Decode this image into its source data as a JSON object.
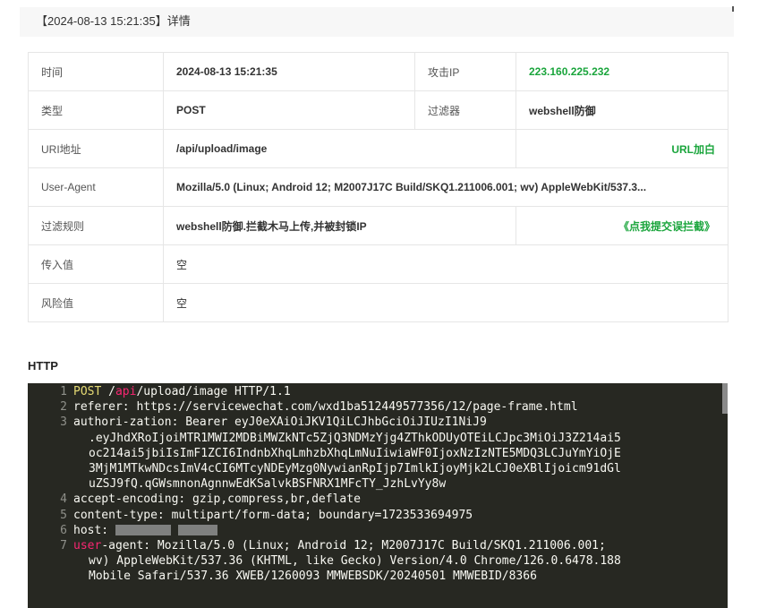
{
  "header": {
    "title": "【2024-08-13 15:21:35】详情"
  },
  "details": {
    "time_label": "时间",
    "time_value": "2024-08-13 15:21:35",
    "attack_ip_label": "攻击IP",
    "attack_ip_value": "223.160.225.232",
    "type_label": "类型",
    "type_value": "POST",
    "filter_label": "过滤器",
    "filter_value": "webshell防御",
    "uri_label": "URI地址",
    "uri_value": "/api/upload/image",
    "uri_action": "URL加白",
    "ua_label": "User-Agent",
    "ua_value": "Mozilla/5.0 (Linux; Android 12; M2007J17C Build/SKQ1.211006.001; wv) AppleWebKit/537.3...",
    "rule_label": "过滤规则",
    "rule_value": "webshell防御.拦截木马上传,并被封锁IP",
    "rule_action": "《点我提交误拦截》",
    "input_label": "传入值",
    "input_value": "空",
    "risk_label": "风险值",
    "risk_value": "空"
  },
  "http": {
    "title": "HTTP",
    "l1_ln": "1",
    "l1_method": "POST",
    "l1_sp": " /",
    "l1_api": "api",
    "l1_rest": "/upload/image HTTP/1.1",
    "l2_ln": "2",
    "l2": "referer: https://servicewechat.com/wxd1ba512449577356/12/page-frame.html",
    "l3_ln": "3",
    "l3_a": "authori-zation: Bearer eyJ0eXAiOiJKV1QiLCJhbGciOiJIUzI1NiJ9",
    "l3_b": ".eyJhdXRoIjoiMTR1MWI2MDBiMWZkNTc5ZjQ3NDMzYjg4ZThkODUyOTEiLCJpc3MiOiJ3Z214ai5",
    "l3_c": "oc214ai5jbiIsImF1ZCI6IndnbXhqLmhzbXhqLmNuIiwiaWF0IjoxNzIzNTE5MDQ3LCJuYmYiOjE",
    "l3_d": "3MjM1MTkwNDcsImV4cCI6MTcyNDEyMzg0NywianRpIjp7ImlkIjoyMjk2LCJ0eXBlIjoicm91dGl",
    "l3_e": "uZSJ9fQ.qGWsmnonAgnnwEdKSalvkBSFNRX1MFcTY_JzhLvYy8w",
    "l4_ln": "4",
    "l4": "accept-encoding: gzip,compress,br,deflate",
    "l5_ln": "5",
    "l5": "content-type: multipart/form-data; boundary=1723533694975",
    "l6_ln": "6",
    "l6": "host: ",
    "l7_ln": "7",
    "l7_key": "user",
    "l7_a": "-agent: Mozilla/5.0 (Linux; Android 12; M2007J17C Build/SKQ1.211006.001;",
    "l7_b": "wv) AppleWebKit/537.36 (KHTML, like Gecko) Version/4.0 Chrome/126.0.6478.188",
    "l7_c": "Mobile Safari/537.36 XWEB/1260093 MMWEBSDK/20240501 MMWEBID/8366"
  }
}
